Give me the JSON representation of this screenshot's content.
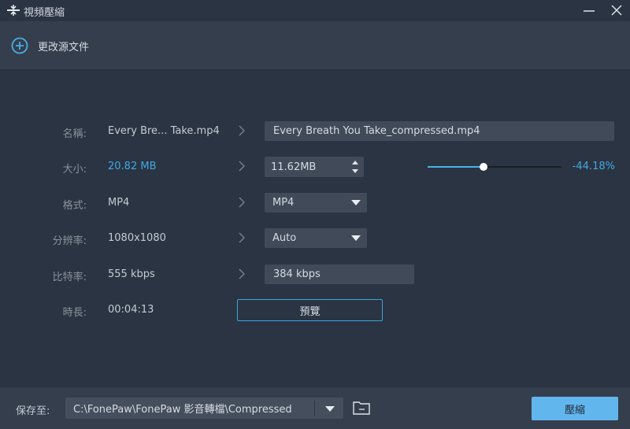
{
  "window": {
    "title": "視頻壓縮",
    "icons": {
      "app": "compress-icon",
      "minimize": "minimize-icon",
      "close": "close-icon"
    }
  },
  "toolbar": {
    "add_source_label": "更改源文件",
    "add_source_icon": "plus-circle-icon"
  },
  "form": {
    "name": {
      "label": "名稱:",
      "source": "Every Bre... Take.mp4",
      "output": "Every Breath You Take_compressed.mp4"
    },
    "size": {
      "label": "大小:",
      "source": "20.82 MB",
      "output": "11.62MB",
      "ratio_change": "-44.18%",
      "slider_fraction": 0.42
    },
    "format": {
      "label": "格式:",
      "source": "MP4",
      "output": "MP4"
    },
    "resolution": {
      "label": "分辨率:",
      "source": "1080x1080",
      "output": "Auto"
    },
    "bitrate": {
      "label": "比特率:",
      "source": "555 kbps",
      "output": "384 kbps"
    },
    "duration": {
      "label": "時長:",
      "source": "00:04:13"
    },
    "preview_label": "預覽"
  },
  "footer": {
    "save_to_label": "保存至:",
    "path": "C:\\FonePaw\\FonePaw 影音轉檔\\Compressed",
    "compress_label": "壓縮",
    "folder_icon": "folder-icon"
  },
  "colors": {
    "accent": "#41a9e6",
    "background": "#2b3442",
    "panel": "#353e4d",
    "field": "#414a59",
    "primary_button": "#62b6ee"
  }
}
